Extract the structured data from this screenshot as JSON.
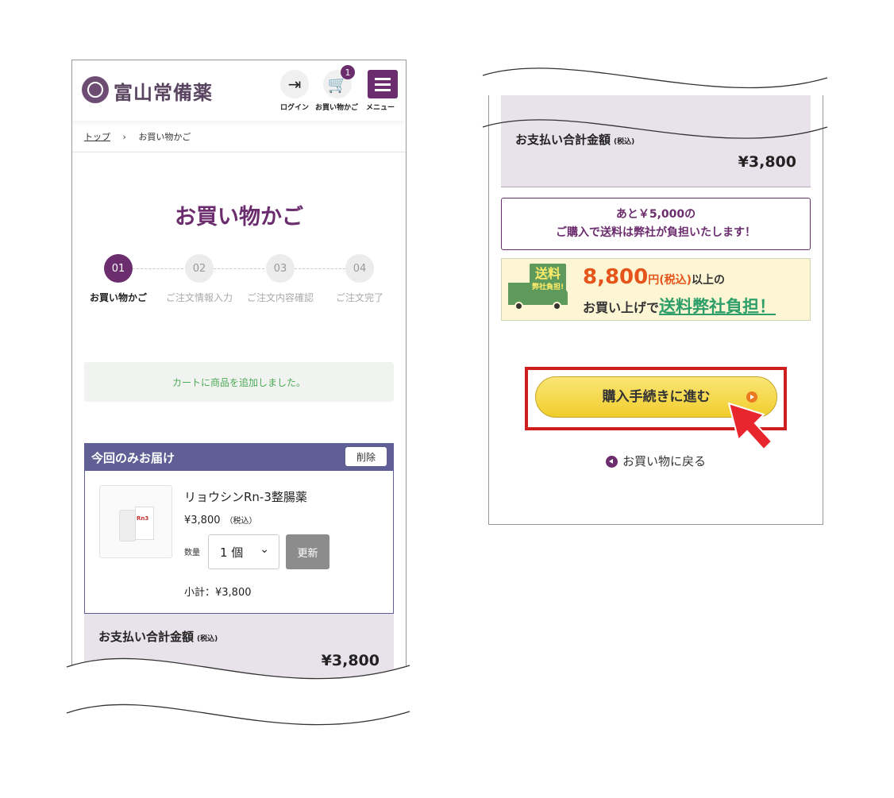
{
  "header": {
    "logo_text": "富山常備薬",
    "login_label": "ログイン",
    "cart_label": "お買い物かご",
    "cart_count": "1",
    "menu_label": "メニュー"
  },
  "breadcrumb": {
    "home": "トップ",
    "separator": "›",
    "current": "お買い物かご"
  },
  "page_title": "お買い物かご",
  "steps": [
    {
      "num": "01",
      "label": "お買い物かご"
    },
    {
      "num": "02",
      "label": "ご注文情報入力"
    },
    {
      "num": "03",
      "label": "ご注文内容確認"
    },
    {
      "num": "04",
      "label": "ご注文完了"
    }
  ],
  "notice": "カートに商品を追加しました。",
  "delivery": {
    "title": "今回のみお届け",
    "delete_label": "削除",
    "product": {
      "name": "リョウシンRn-3整腸薬",
      "price": "¥3,800",
      "tax": "（税込）",
      "qty_label": "数量",
      "qty_value": "1 個",
      "update_label": "更新",
      "subtotal": "小計：¥3,800"
    }
  },
  "total": {
    "label": "お支払い合計金額",
    "tax": "(税込)",
    "amount": "¥3,800"
  },
  "shipping_notice": {
    "line1": "あと￥5,000の",
    "line2": "ご購入で送料は弊社が負担いたします！"
  },
  "banner": {
    "stamp_big": "送料",
    "stamp_small": "弊社負担!",
    "amount": "8,800",
    "yen_tax": "円(税込)",
    "l1_suffix": "以上の",
    "l2_prefix": "お買い上げで",
    "l2_emph": "送料弊社負担！"
  },
  "checkout_label": "購入手続きに進む",
  "back_label": "お買い物に戻る",
  "colors": {
    "brand": "#6b2d6e",
    "delivery_header": "#5f5f96",
    "highlight": "#cf1e1e",
    "button": "#f0cd2c"
  }
}
